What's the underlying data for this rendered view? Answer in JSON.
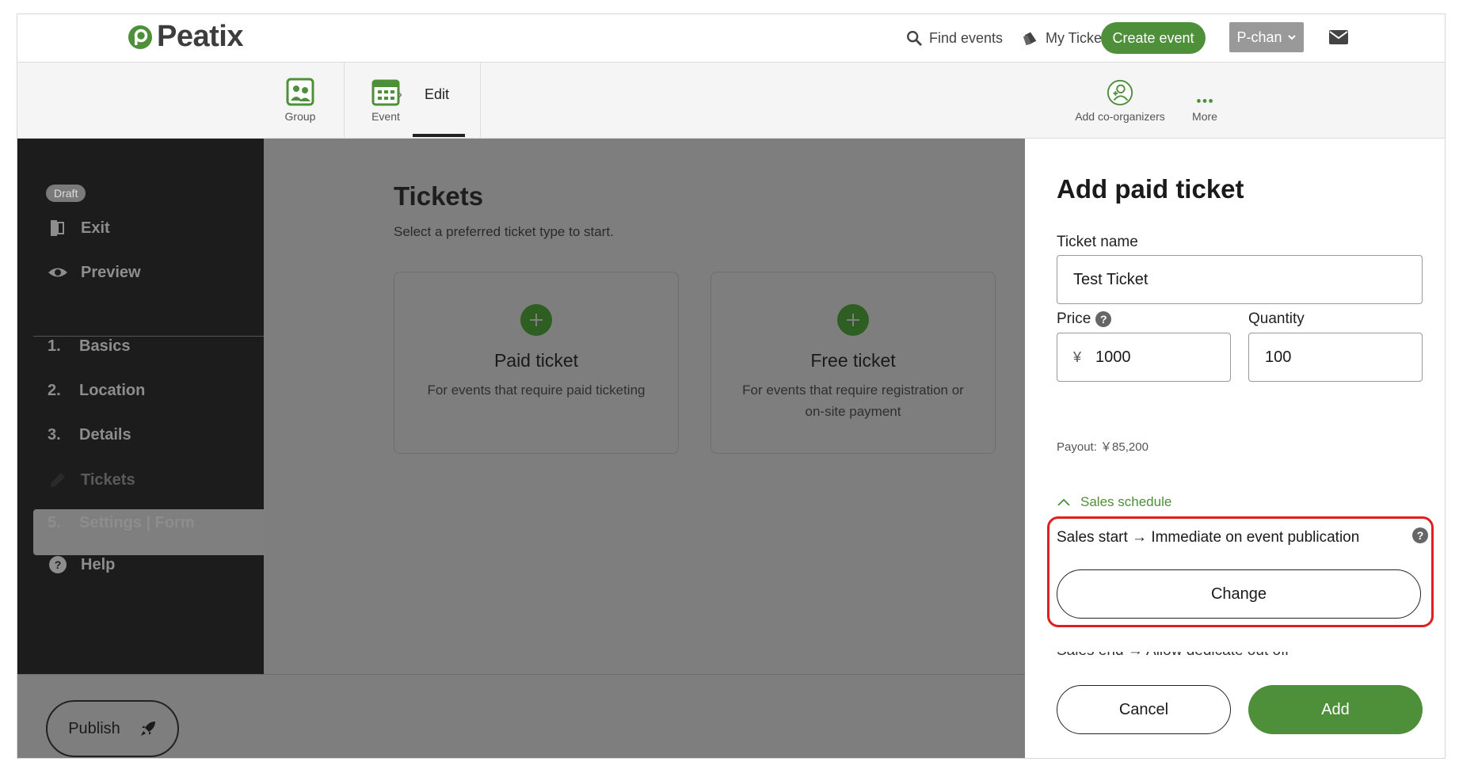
{
  "header": {
    "logo_text": "Peatix",
    "find_events": "Find events",
    "my_tickets": "My Tickets",
    "create_event": "Create event",
    "user_name": "P-chan"
  },
  "subnav": {
    "group": "Group",
    "event": "Event",
    "edit": "Edit",
    "add_coorganizers": "Add co-organizers",
    "more": "More"
  },
  "sidebar": {
    "status_badge": "Draft",
    "exit": "Exit",
    "preview": "Preview",
    "steps": [
      {
        "num": "1.",
        "label": "Basics"
      },
      {
        "num": "2.",
        "label": "Location"
      },
      {
        "num": "3.",
        "label": "Details"
      },
      {
        "num": "",
        "label": "Tickets"
      },
      {
        "num": "5.",
        "label": "Settings | Form"
      }
    ],
    "help": "Help",
    "publish": "Publish"
  },
  "main": {
    "title": "Tickets",
    "subtitle": "Select a preferred ticket type to start.",
    "cards": [
      {
        "title": "Paid ticket",
        "desc": "For events that require paid ticketing"
      },
      {
        "title": "Free ticket",
        "desc": "For events that require registration or on-site payment"
      }
    ]
  },
  "panel": {
    "title": "Add paid ticket",
    "ticket_name_label": "Ticket name",
    "ticket_name_value": "Test Ticket",
    "price_label": "Price",
    "price_currency": "¥",
    "price_value": "1000",
    "quantity_label": "Quantity",
    "quantity_value": "100",
    "payout": "Payout: ￥85,200",
    "sales_schedule": "Sales schedule",
    "sales_start": "Sales start → Immediate on event publication",
    "change": "Change",
    "sales_end_partial": "Sales end → Allow dedicate out off",
    "cancel": "Cancel",
    "add": "Add"
  },
  "colors": {
    "brand_green": "#4e8f3a",
    "highlight_red": "#e02020",
    "sidebar_bg": "#1c1c1c"
  }
}
